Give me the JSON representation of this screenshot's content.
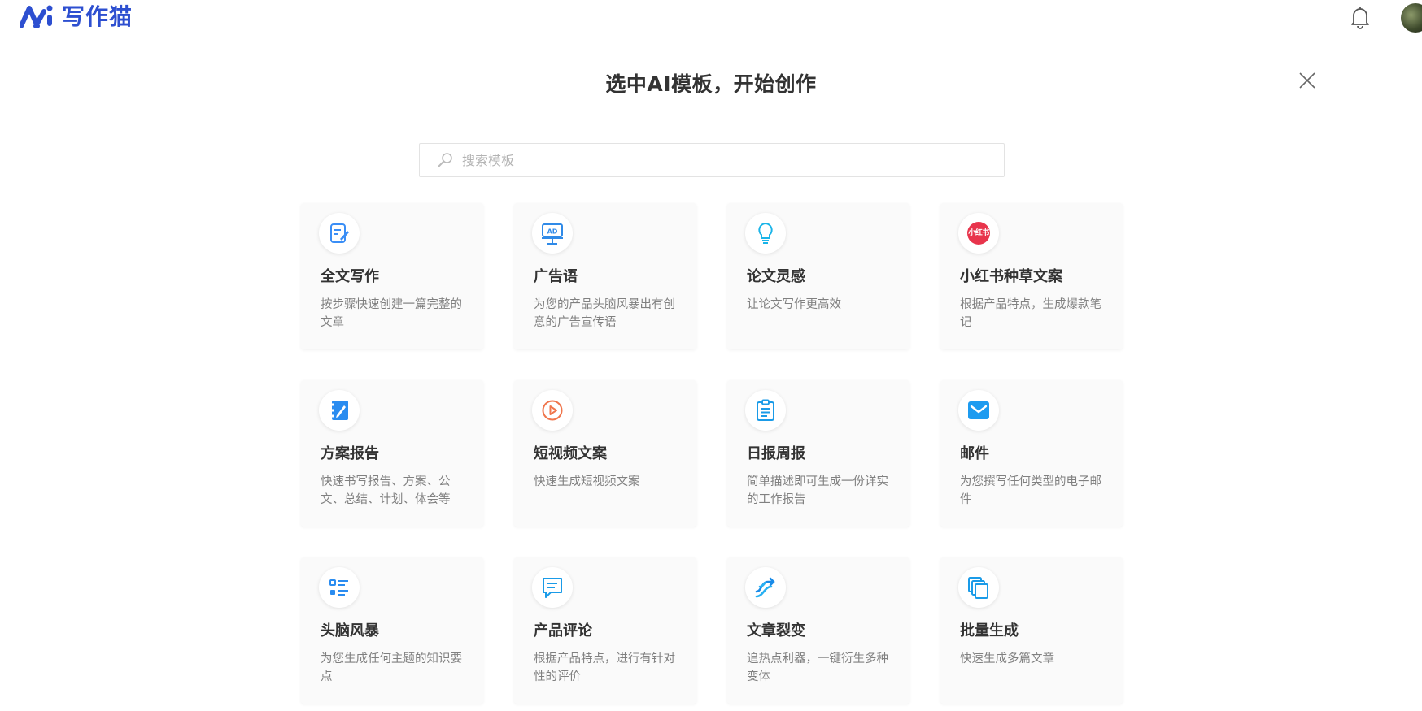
{
  "app": {
    "name": "写作猫"
  },
  "dialog": {
    "title": "选中AI模板，开始创作",
    "search_placeholder": "搜索模板"
  },
  "icons": {
    "logo": "ai-logo-icon",
    "bell": "bell-icon",
    "close": "close-icon",
    "search": "search-icon"
  },
  "colors": {
    "brand": "#2d4fd0",
    "accent_blue": "#1d9bf0"
  },
  "templates": [
    {
      "title": "全文写作",
      "desc": "按步骤快速创建一篇完整的文章",
      "icon": "edit-document-icon"
    },
    {
      "title": "广告语",
      "desc": "为您的产品头脑风暴出有创意的广告宣传语",
      "icon": "ad-board-icon"
    },
    {
      "title": "论文灵感",
      "desc": "让论文写作更高效",
      "icon": "lightbulb-icon"
    },
    {
      "title": "小红书种草文案",
      "desc": "根据产品特点，生成爆款笔记",
      "icon": "xiaohongshu-icon",
      "badge": "小红书"
    },
    {
      "title": "方案报告",
      "desc": "快速书写报告、方案、公文、总结、计划、体会等",
      "icon": "notebook-pen-icon"
    },
    {
      "title": "短视频文案",
      "desc": "快速生成短视频文案",
      "icon": "play-circle-icon"
    },
    {
      "title": "日报周报",
      "desc": "简单描述即可生成一份详实的工作报告",
      "icon": "clipboard-icon"
    },
    {
      "title": "邮件",
      "desc": "为您撰写任何类型的电子邮件",
      "icon": "mail-icon"
    },
    {
      "title": "头脑风暴",
      "desc": "为您生成任何主题的知识要点",
      "icon": "list-icon"
    },
    {
      "title": "产品评论",
      "desc": "根据产品特点，进行有针对性的评价",
      "icon": "comment-icon"
    },
    {
      "title": "文章裂变",
      "desc": "追热点利器，一键衍生多种变体",
      "icon": "split-arrows-icon"
    },
    {
      "title": "批量生成",
      "desc": "快速生成多篇文章",
      "icon": "copies-icon"
    }
  ]
}
